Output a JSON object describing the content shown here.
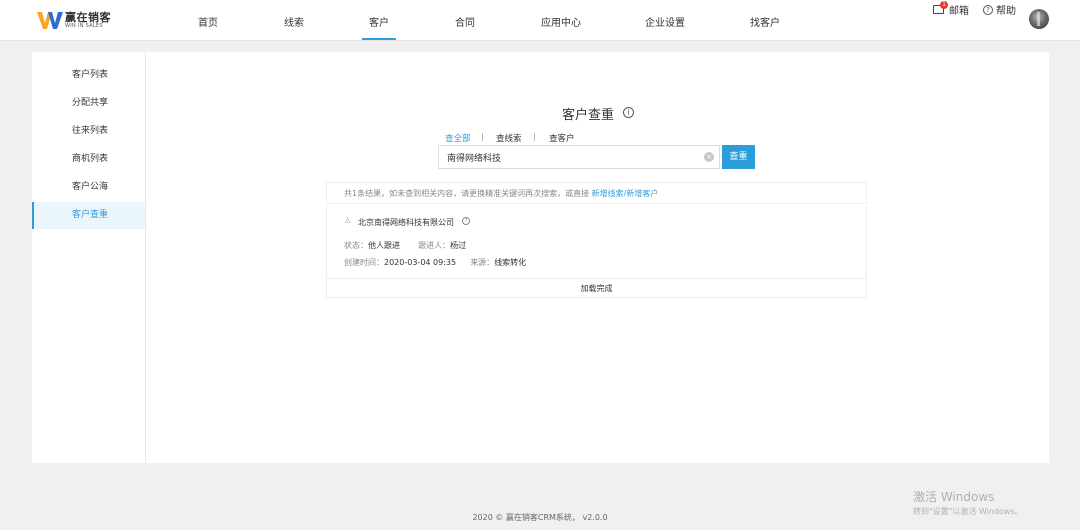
{
  "brand": {
    "title": "赢在销客",
    "subtitle": "WIN IN SALES",
    "colors": {
      "orange": "#f5a623",
      "blue": "#2d6fd1"
    }
  },
  "nav": {
    "items": [
      {
        "label": "首页",
        "active": false
      },
      {
        "label": "线索",
        "active": false
      },
      {
        "label": "客户",
        "active": true
      },
      {
        "label": "合同",
        "active": false
      },
      {
        "label": "应用中心",
        "active": false
      },
      {
        "label": "企业设置",
        "active": false
      },
      {
        "label": "找客户",
        "active": false
      }
    ],
    "accent": "#2d9cdb"
  },
  "header_right": {
    "mail_label": "邮箱",
    "mail_badge": "1",
    "help_label": "帮助"
  },
  "sidebar": {
    "items": [
      {
        "label": "客户列表",
        "active": false
      },
      {
        "label": "分配共享",
        "active": false
      },
      {
        "label": "往来列表",
        "active": false
      },
      {
        "label": "商机列表",
        "active": false
      },
      {
        "label": "客户公海",
        "active": false
      },
      {
        "label": "客户查重",
        "active": true
      }
    ]
  },
  "main": {
    "title": "客户查重",
    "tabs": [
      {
        "label": "查全部",
        "active": true
      },
      {
        "label": "查线索",
        "active": false
      },
      {
        "label": "查客户",
        "active": false
      }
    ],
    "search": {
      "value": "南得网络科技",
      "button_label": "查重"
    },
    "result_note": {
      "text": "共1条结果，如未查到相关内容，请更换精准关键词再次搜索，或直接",
      "link_label": "新增线索/新增客户"
    },
    "results": [
      {
        "company": "北京南得网络科技有限公司",
        "status_label": "状态：",
        "status_value": "他人跟进",
        "follower_label": "跟进人：",
        "follower_value": "杨过",
        "created_label": "创建时间：",
        "created_value": "2020-03-04 09:35",
        "source_label": "来源：",
        "source_value": "线索转化"
      }
    ],
    "load_complete": "加载完成"
  },
  "footer": {
    "text": "2020 © 赢在销客CRM系统，  v2.0.0"
  },
  "watermark": {
    "title": "激活 Windows",
    "subtitle": "转到\"设置\"以激活 Windows。"
  }
}
